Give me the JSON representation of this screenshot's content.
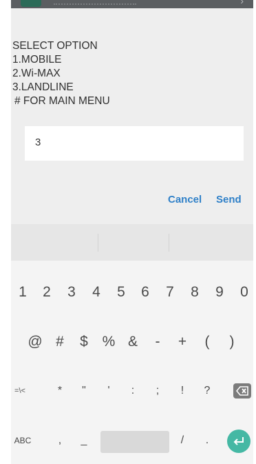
{
  "dialog": {
    "message_lines": [
      "SELECT OPTION",
      "1.MOBILE",
      "2.Wi-MAX",
      "3.LANDLINE",
      " # FOR MAIN MENU"
    ],
    "input_value": "3",
    "cancel_label": "Cancel",
    "send_label": "Send",
    "accent_color": "#2f80c8"
  },
  "keyboard": {
    "row1": [
      "1",
      "2",
      "3",
      "4",
      "5",
      "6",
      "7",
      "8",
      "9",
      "0"
    ],
    "row2": [
      "@",
      "#",
      "$",
      "%",
      "&",
      "-",
      "+",
      "(",
      ")"
    ],
    "row3": [
      "=\\<",
      "*",
      "\"",
      "'",
      ":",
      ";",
      "!",
      "?"
    ],
    "row4": {
      "abc": "ABC",
      "comma": ",",
      "underscore": "_",
      "slash": "/",
      "period": "."
    },
    "icons": {
      "backspace": "backspace-icon",
      "enter": "enter-icon"
    },
    "enter_color": "#45b8a4"
  }
}
